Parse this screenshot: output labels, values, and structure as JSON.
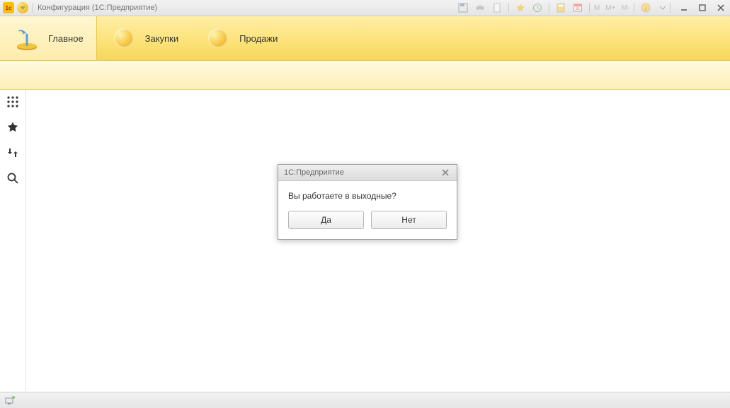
{
  "titlebar": {
    "title": "Конфигурация (1С:Предприятие)",
    "logo_text": "1c",
    "m_labels": [
      "M",
      "M+",
      "M-"
    ]
  },
  "tabs": {
    "main": "Главное",
    "purchases": "Закупки",
    "sales": "Продажи"
  },
  "dialog": {
    "title": "1С:Предприятие",
    "message": "Вы работаете в выходные?",
    "yes": "Да",
    "no": "Нет"
  }
}
